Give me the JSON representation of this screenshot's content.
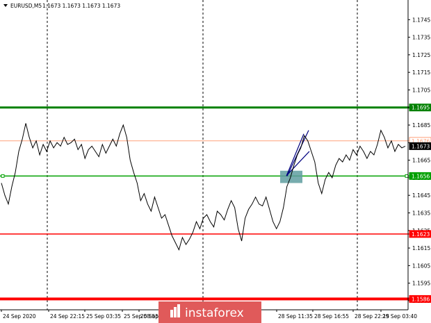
{
  "header": {
    "symbol": "EURUSD,M5",
    "ohlc": "1.1673 1.1673 1.1673 1.1673"
  },
  "watermark": {
    "brand": "instaforex"
  },
  "colors": {
    "price_line": "#000000",
    "resistance_green": "#008000",
    "entry_green": "#00a000",
    "support_red": "#ff0000",
    "current_line": "#ffa07a",
    "box_fill": "#5f9ea0",
    "trend_lines": "#000080",
    "watermark_bg": "#e05a5a"
  },
  "chart_data": {
    "type": "line",
    "symbol": "EURUSD",
    "timeframe": "M5",
    "ylim": [
      1.1583,
      1.1755
    ],
    "y_ticks": [
      "1.1745",
      "1.1735",
      "1.1725",
      "1.1715",
      "1.1705",
      "1.1695",
      "1.1685",
      "1.1675",
      "1.1665",
      "1.1655",
      "1.1645",
      "1.1635",
      "1.1625",
      "1.1615",
      "1.1605",
      "1.1595",
      "1.1585"
    ],
    "x_ticks": [
      "24 Sep 2020",
      "24 Sep 22:15",
      "25 Sep 03:35",
      "25 Sep 08:55",
      "25 Sep",
      "28 Sep 11:35",
      "28 Sep 16:55",
      "28 Sep 22:15",
      "29 Sep 03:40"
    ],
    "levels": [
      {
        "value": 1.1695,
        "label": "1.1695",
        "color": "#008000"
      },
      {
        "value": 1.1676,
        "label": "1.1676",
        "color": "#ffa07a"
      },
      {
        "value": 1.1673,
        "label": "1.1673",
        "color": "#000000"
      },
      {
        "value": 1.1656,
        "label": "1.1656",
        "color": "#00a000"
      },
      {
        "value": 1.1623,
        "label": "1.1623",
        "color": "#ff0000"
      },
      {
        "value": 1.1586,
        "label": "1.1586",
        "color": "#ff0000"
      }
    ],
    "series": [
      {
        "values": [
          1.1652,
          1.1645,
          1.164,
          1.165,
          1.1658,
          1.167,
          1.1677,
          1.1686,
          1.1678,
          1.1672,
          1.1676,
          1.1668,
          1.1674,
          1.167,
          1.1676,
          1.1672,
          1.1675,
          1.1673,
          1.1678,
          1.1674,
          1.1675,
          1.1677,
          1.1671,
          1.1674,
          1.1666,
          1.1671,
          1.1673,
          1.167,
          1.1667,
          1.1674,
          1.1669,
          1.1673,
          1.1677,
          1.1673,
          1.168,
          1.1685,
          1.1678,
          1.1665,
          1.1658,
          1.1652,
          1.1642,
          1.1646,
          1.164,
          1.1636,
          1.1644,
          1.1638,
          1.1632,
          1.1634,
          1.1628,
          1.1622,
          1.1618,
          1.1614,
          1.1621,
          1.1617,
          1.162,
          1.1624,
          1.163,
          1.1626,
          1.1632,
          1.1634,
          1.163,
          1.1627,
          1.1636,
          1.1634,
          1.1631,
          1.1637,
          1.1642,
          1.1638,
          1.1626,
          1.1619,
          1.1632,
          1.1637,
          1.164,
          1.1644,
          1.164,
          1.1639,
          1.1644,
          1.1637,
          1.163,
          1.1626,
          1.163,
          1.1638,
          1.165,
          1.1655,
          1.1662,
          1.1668,
          1.1672,
          1.1679,
          1.1676,
          1.167,
          1.1664,
          1.1652,
          1.1646,
          1.1654,
          1.1658,
          1.1655,
          1.1662,
          1.1666,
          1.1664,
          1.1668,
          1.1665,
          1.1671,
          1.1668,
          1.1673,
          1.167,
          1.1666,
          1.167,
          1.1668,
          1.1674,
          1.1682,
          1.1678,
          1.1672,
          1.1676,
          1.167,
          1.1674,
          1.1672,
          1.1673
        ]
      }
    ]
  }
}
